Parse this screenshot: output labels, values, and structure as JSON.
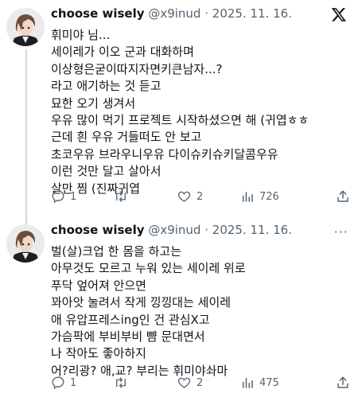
{
  "tweets": [
    {
      "author": {
        "name": "choose wisely",
        "handle": "@x9inud",
        "separator": "·"
      },
      "date": "2025. 11. 16.",
      "lines": [
        "휘미야 님...",
        "세이레가 이오 군과 대화하며",
        "이상형은굳이따지자면키큰남자...?",
        "라고 애기하는 것 듣고",
        "묘한 오기 생겨서",
        "우유 많이 먹기 프로젝트 시작하셨으면 해 (귀엽ㅎㅎ",
        "근데 흰 우유 거들떠도 안 보고",
        "초코우유 브라우니우유 다이슈키슈키달콤우유",
        "이런 것만 달고 살아서",
        "살만 찜 (진짜귀엽"
      ],
      "actions": {
        "replies": "1",
        "retweets": "",
        "likes": "2",
        "views": "726"
      },
      "icon": "x-logo-icon"
    },
    {
      "author": {
        "name": "choose wisely",
        "handle": "@x9inud",
        "separator": "·"
      },
      "date": "2025. 11. 16.",
      "lines": [
        "벌(살)크업 한 몸을 하고는",
        "아무것도 모르고 누워 있는 세이레 위로",
        "푸닥 엎어져 안으면",
        "꽈아앗 눌려서 작게 낑낑대는 세이레",
        "애 유압프레스ing인 건 관심X고",
        "가슴팍에 부비부비 뺨 문대면서",
        "나 작아도 좋아하지",
        "어?리광? 애,교? 부리는 휘미야솨마"
      ],
      "actions": {
        "replies": "1",
        "retweets": "",
        "likes": "2",
        "views": "475"
      },
      "icon": "more-options-icon",
      "more_label": "···"
    }
  ]
}
